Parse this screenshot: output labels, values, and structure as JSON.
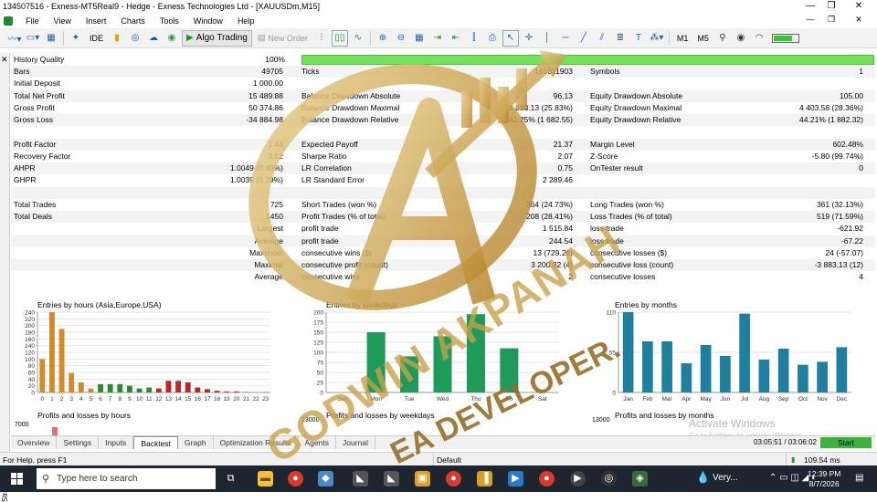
{
  "window": {
    "title": "134507516 - Exness-MT5Real9 - Hedge - Exness Technologies Ltd - [XAUUSDm,M15]",
    "minimize": "—",
    "maximize": "❐",
    "close": "✕"
  },
  "menu": [
    "File",
    "View",
    "Insert",
    "Charts",
    "Tools",
    "Window",
    "Help"
  ],
  "mdi": {
    "minimize": "—",
    "restore": "❐",
    "close": "✕"
  },
  "toolbar": {
    "ide": "IDE",
    "algo_trading": "Algo Trading",
    "new_order": "New Order",
    "m1": "M1",
    "m5": "M5"
  },
  "sidebar": {
    "label": "Strategy Tester",
    "close": "✕"
  },
  "report": {
    "history_quality": {
      "label": "History Quality",
      "value": "100%",
      "fill_pct": 100
    },
    "rows": [
      {
        "c1l": "Bars",
        "c1v": "49705",
        "c2l": "Ticks",
        "c2v": "161811903",
        "c3l": "Symbols",
        "c3v": "1"
      },
      {
        "c1l": "Initial Deposit",
        "c1v": "1 000.00",
        "c2l": "",
        "c2v": "",
        "c3l": "",
        "c3v": ""
      },
      {
        "c1l": "Total Net Profit",
        "c1v": "15 489.88",
        "c2l": "Balance Drawdown Absolute",
        "c2v": "96.13",
        "c3l": "Equity Drawdown Absolute",
        "c3v": "105.00"
      },
      {
        "c1l": "Gross Profit",
        "c1v": "50 374.86",
        "c2l": "Balance Drawdown Maximal",
        "c2v": "3 883.13 (25.83%)",
        "c3l": "Equity Drawdown Maximal",
        "c3v": "4 403.58 (28.36%)"
      },
      {
        "c1l": "Gross Loss",
        "c1v": "-34 884.98",
        "c2l": "Balance Drawdown Relative",
        "c2v": "41.25% (1 682.55)",
        "c3l": "Equity Drawdown Relative",
        "c3v": "44.21% (1 882.32)"
      },
      {
        "c1l": "",
        "c1v": "",
        "c2l": "",
        "c2v": "",
        "c3l": "",
        "c3v": ""
      },
      {
        "c1l": "Profit Factor",
        "c1v": "1.44",
        "c2l": "Expected Payoff",
        "c2v": "21.37",
        "c3l": "Margin Level",
        "c3v": "602.48%"
      },
      {
        "c1l": "Recovery Factor",
        "c1v": "3.52",
        "c2l": "Sharpe Ratio",
        "c2v": "2.07",
        "c3l": "Z-Score",
        "c3v": "-5.80 (99.74%)"
      },
      {
        "c1l": "AHPR",
        "c1v": "1.0049 (0.49%)",
        "c2l": "LR Correlation",
        "c2v": "0.75",
        "c3l": "OnTester result",
        "c3v": "0"
      },
      {
        "c1l": "GHPR",
        "c1v": "1.0039 (0.39%)",
        "c2l": "LR Standard Error",
        "c2v": "2 289.46",
        "c3l": "",
        "c3v": ""
      },
      {
        "c1l": "",
        "c1v": "",
        "c2l": "",
        "c2v": "",
        "c3l": "",
        "c3v": ""
      },
      {
        "c1l": "Total Trades",
        "c1v": "725",
        "c2l": "Short Trades (won %)",
        "c2v": "364 (24.73%)",
        "c3l": "Long Trades (won %)",
        "c3v": "361 (32.13%)"
      },
      {
        "c1l": "Total Deals",
        "c1v": "1450",
        "c2l": "Profit Trades (% of total)",
        "c2v": "208 (28.41%)",
        "c3l": "Loss Trades (% of total)",
        "c3v": "519 (71.59%)"
      },
      {
        "c1l": "",
        "c1v": "Largest",
        "c2l": "profit trade",
        "c2v": "1 515.84",
        "c3l": "loss trade",
        "c3v": "-621.92"
      },
      {
        "c1l": "",
        "c1v": "Average",
        "c2l": "profit trade",
        "c2v": "244.54",
        "c3l": "loss trade",
        "c3v": "-67.22"
      },
      {
        "c1l": "",
        "c1v": "Maximum",
        "c2l": "consecutive wins ($)",
        "c2v": "13 (729.26)",
        "c3l": "consecutive losses ($)",
        "c3v": "24 (-57.07)"
      },
      {
        "c1l": "",
        "c1v": "Maximal",
        "c2l": "consecutive profit (count)",
        "c2v": "3 200.32 (4)",
        "c3l": "consecutive loss (count)",
        "c3v": "-3 883.13 (12)"
      },
      {
        "c1l": "",
        "c1v": "Average",
        "c2l": "consecutive wins",
        "c2v": "2",
        "c3l": "consecutive losses",
        "c3v": "4"
      }
    ]
  },
  "chart_data": [
    {
      "type": "bar",
      "title": "Entries by hours (Asia,Europe,USA)",
      "categories": [
        "0",
        "1",
        "2",
        "3",
        "4",
        "5",
        "6",
        "7",
        "8",
        "9",
        "10",
        "11",
        "12",
        "13",
        "14",
        "15",
        "16",
        "17",
        "18",
        "19",
        "20",
        "21",
        "22",
        "23"
      ],
      "values": [
        100,
        240,
        190,
        58,
        30,
        12,
        25,
        25,
        25,
        20,
        12,
        15,
        12,
        35,
        35,
        30,
        15,
        10,
        5,
        3,
        3,
        1,
        0,
        1
      ],
      "colors": [
        "#d08c28",
        "#d08c28",
        "#d08c28",
        "#d08c28",
        "#d08c28",
        "#d08c28",
        "#2e8a2e",
        "#2e8a2e",
        "#2e8a2e",
        "#2e8a2e",
        "#2e8a2e",
        "#2e8a2e",
        "#b82828",
        "#b82828",
        "#b82828",
        "#b82828",
        "#b82828",
        "#b82828",
        "#b82828",
        "#b82828",
        "#b82828",
        "#b82828",
        "#b82828",
        "#b82828"
      ],
      "yticks": [
        0,
        20,
        40,
        60,
        80,
        100,
        120,
        140,
        160,
        180,
        200,
        220,
        240
      ],
      "ylim": [
        0,
        240
      ]
    },
    {
      "type": "bar",
      "title": "Entries by weekdays",
      "categories": [
        "Sun",
        "Mon",
        "Tue",
        "Wed",
        "Thu",
        "Fri",
        "Sat"
      ],
      "values": [
        0,
        150,
        90,
        140,
        195,
        110,
        0
      ],
      "color": "#1e9a5a",
      "yticks": [
        0,
        25,
        50,
        75,
        100,
        125,
        150,
        175,
        200
      ],
      "ylim": [
        0,
        200
      ]
    },
    {
      "type": "bar",
      "title": "Entries by months",
      "categories": [
        "Jan",
        "Feb",
        "Mar",
        "Apr",
        "May",
        "Jun",
        "Jul",
        "Aug",
        "Sep",
        "Oct",
        "Nov",
        "Dec"
      ],
      "values": [
        110,
        70,
        70,
        40,
        65,
        50,
        108,
        45,
        60,
        38,
        42,
        62
      ],
      "color": "#1e7fa0",
      "yticks": [
        0,
        55,
        110
      ],
      "ylim": [
        0,
        110
      ]
    }
  ],
  "lower_charts": [
    {
      "title": "Profits and losses by hours",
      "ytick": "7000"
    },
    {
      "title": "Profits and losses by weekdays",
      "ytick": "13000"
    },
    {
      "title": "Profits and losses by months",
      "ytick": "13000"
    }
  ],
  "activate_windows": {
    "title": "Activate Windows",
    "subtitle": "Go to Settings to activate Windows."
  },
  "tabs": [
    "Overview",
    "Settings",
    "Inputs",
    "Backtest",
    "Graph",
    "Optimization Results",
    "Agents",
    "Journal"
  ],
  "active_tab": "Backtest",
  "tester_clock": "03:05:51 / 03:06:02",
  "start_button": "Start",
  "status": {
    "help": "For Help, press F1",
    "profile": "Default",
    "ping": "109.54 ms"
  },
  "watermark": {
    "name": "GODWIN AKPANAH",
    "role": "EA DEVELOPER."
  },
  "taskbar": {
    "search_placeholder": "Type here to search",
    "weather": "Very...",
    "time": "12:39 PM",
    "date": "8/7/2026"
  }
}
